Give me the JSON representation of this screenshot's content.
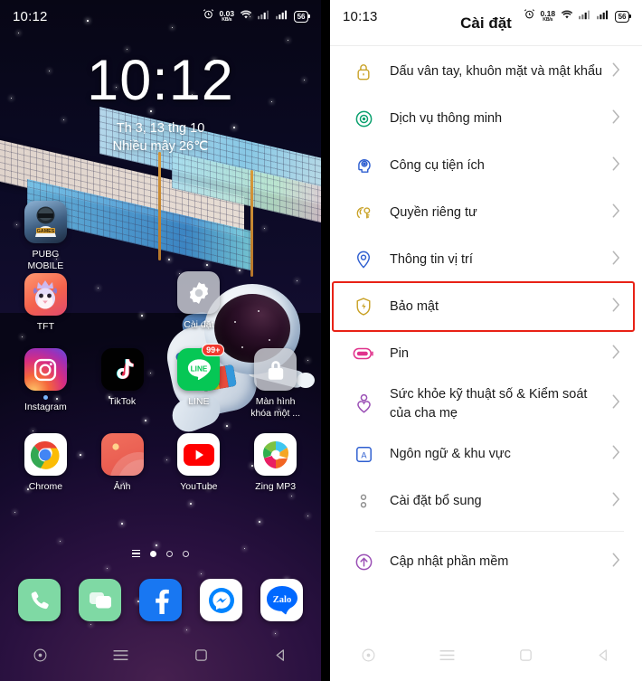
{
  "left_phone": {
    "status_bar": {
      "time": "10:12",
      "alarm_icon": "alarm-clock-icon",
      "net_speed_value": "0.03",
      "net_speed_unit": "KB/s",
      "wifi_icon": "wifi-icon",
      "signal1_icon": "signal-bars-icon",
      "signal2_icon": "signal-bars-icon",
      "battery_level": "56"
    },
    "clock_widget": {
      "time": "10:12",
      "date": "Th 3, 13 thg 10",
      "weather": "Nhiều mây 26℃"
    },
    "app_rows": [
      [
        {
          "label": "PUBG\nMOBILE",
          "icon": "pubg-mobile-app-icon"
        },
        {
          "label": "",
          "icon": ""
        },
        {
          "label": "Cài đặt",
          "icon": "settings-app-icon"
        },
        {
          "label": "",
          "icon": ""
        }
      ],
      [
        {
          "label": "TFT",
          "icon": "tft-app-icon"
        },
        {
          "label": "",
          "icon": ""
        },
        {
          "label": "",
          "icon": ""
        },
        {
          "label": "",
          "icon": ""
        }
      ],
      [
        {
          "label": "Instagram",
          "icon": "instagram-app-icon"
        },
        {
          "label": "TikTok",
          "icon": "tiktok-app-icon"
        },
        {
          "label": "LINE",
          "icon": "line-app-icon",
          "badge": "99+"
        },
        {
          "label": "Màn hình\nkhóa một ...",
          "icon": "lock-screen-app-icon"
        }
      ],
      [
        {
          "label": "Chrome",
          "icon": "chrome-app-icon"
        },
        {
          "label": "Ảnh",
          "icon": "photos-app-icon"
        },
        {
          "label": "YouTube",
          "icon": "youtube-app-icon"
        },
        {
          "label": "Zing MP3",
          "icon": "zing-mp3-app-icon"
        }
      ]
    ],
    "page_indicator": {
      "pages": 3,
      "active_index": 0,
      "has_list_marker": true
    },
    "dock": [
      {
        "label": "Phone",
        "icon": "phone-app-icon"
      },
      {
        "label": "Messages",
        "icon": "messages-app-icon"
      },
      {
        "label": "Facebook",
        "icon": "facebook-app-icon"
      },
      {
        "label": "Messenger",
        "icon": "messenger-app-icon"
      },
      {
        "label": "Zalo",
        "icon": "zalo-app-icon"
      }
    ],
    "nav_bar": [
      {
        "name": "assistant-button",
        "icon": "circle-dot-icon"
      },
      {
        "name": "menu-button",
        "icon": "hamburger-icon"
      },
      {
        "name": "home-button",
        "icon": "square-icon"
      },
      {
        "name": "back-button",
        "icon": "triangle-left-icon"
      }
    ]
  },
  "right_phone": {
    "status_bar": {
      "time": "10:13",
      "alarm_icon": "alarm-clock-icon",
      "net_speed_value": "0.18",
      "net_speed_unit": "KB/s",
      "wifi_icon": "wifi-icon",
      "signal1_icon": "signal-bars-icon",
      "signal2_icon": "signal-bars-icon",
      "battery_level": "56"
    },
    "title": "Cài đặt",
    "highlight_color": "#e82216",
    "settings_items": [
      {
        "label": "Dấu vân tay, khuôn mặt và mật khẩu",
        "icon": "lock-icon",
        "color": "#c9a227",
        "chevron": "chevron-right-icon",
        "highlighted": false
      },
      {
        "label": "Dịch vụ thông minh",
        "icon": "smart-services-eye-icon",
        "color": "#0aa06e",
        "chevron": "chevron-right-icon",
        "highlighted": false
      },
      {
        "label": "Công cụ tiện ích",
        "icon": "utility-tools-head-icon",
        "color": "#2f5fd0",
        "chevron": "chevron-right-icon",
        "highlighted": false
      },
      {
        "label": "Quyền riêng tư",
        "icon": "privacy-key-icon",
        "color": "#c9a227",
        "chevron": "chevron-right-icon",
        "highlighted": false
      },
      {
        "label": "Thông tin vị trí",
        "icon": "location-pin-icon",
        "color": "#2f5fd0",
        "chevron": "chevron-right-icon",
        "highlighted": false
      },
      {
        "label": "Bảo mật",
        "icon": "security-shield-icon",
        "color": "#c9a227",
        "chevron": "chevron-right-icon",
        "highlighted": true
      },
      {
        "label": "Pin",
        "icon": "battery-icon",
        "color": "#e0338c",
        "chevron": "chevron-right-icon",
        "highlighted": false
      },
      {
        "label": "Sức khỏe kỹ thuật số & Kiểm soát của cha mẹ",
        "icon": "digital-wellbeing-icon",
        "color": "#9a4fb5",
        "chevron": "chevron-right-icon",
        "highlighted": false
      },
      {
        "label": "Ngôn ngữ & khu vực",
        "icon": "language-icon",
        "color": "#2f5fd0",
        "chevron": "chevron-right-icon",
        "highlighted": false
      },
      {
        "label": "Cài đặt bổ sung",
        "icon": "additional-settings-icon",
        "color": "#8d8d8d",
        "chevron": "chevron-right-icon",
        "highlighted": false
      },
      {
        "label": "Cập nhật phần mềm",
        "icon": "software-update-icon",
        "color": "#9a4fb5",
        "chevron": "chevron-right-icon",
        "separator_before": true,
        "highlighted": false
      }
    ],
    "nav_bar": [
      {
        "name": "assistant-button",
        "icon": "circle-dot-icon"
      },
      {
        "name": "menu-button",
        "icon": "hamburger-icon"
      },
      {
        "name": "home-button",
        "icon": "square-icon"
      },
      {
        "name": "back-button",
        "icon": "triangle-left-icon"
      }
    ]
  }
}
